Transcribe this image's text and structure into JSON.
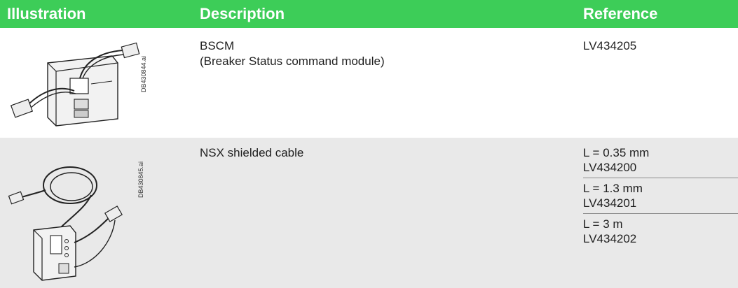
{
  "header": {
    "col_illustration": "Illustration",
    "col_description": "Description",
    "col_reference": "Reference"
  },
  "rows": [
    {
      "image_code": "DB430844.ai",
      "description_line1": "BSCM",
      "description_line2": "(Breaker Status command module)",
      "reference": "LV434205"
    },
    {
      "image_code": "DB430845.ai",
      "description_line1": "NSX shielded cable",
      "variants": [
        {
          "length": "L = 0.35 mm",
          "reference": "LV434200"
        },
        {
          "length": "L = 1.3 mm",
          "reference": "LV434201"
        },
        {
          "length": "L = 3 m",
          "reference": "LV434202"
        }
      ]
    }
  ],
  "colors": {
    "header_bg": "#3dcd58",
    "alt_row_bg": "#e9e9e9",
    "header_text": "#ffffff"
  }
}
